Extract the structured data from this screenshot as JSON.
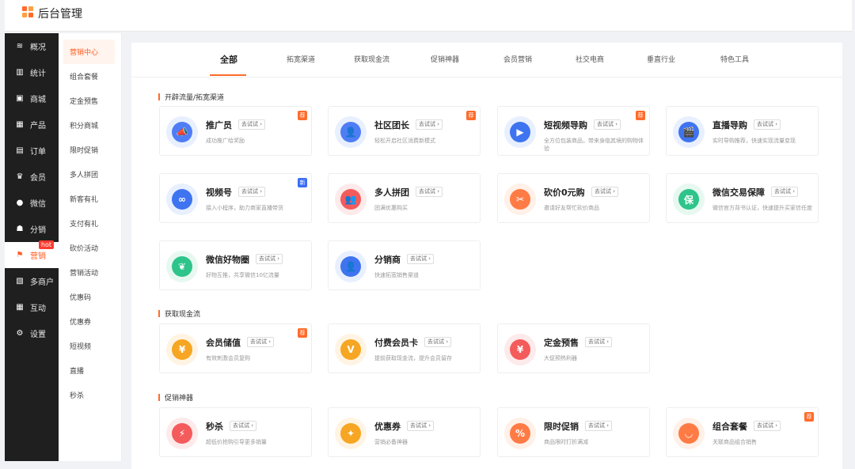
{
  "app": {
    "title": "后台管理"
  },
  "primary_nav": [
    {
      "label": "概况",
      "icon": "stack-icon",
      "glyph": "≋"
    },
    {
      "label": "统计",
      "icon": "bar-chart-icon",
      "glyph": "▥"
    },
    {
      "label": "商城",
      "icon": "store-icon",
      "glyph": "▣"
    },
    {
      "label": "产品",
      "icon": "grid-icon",
      "glyph": "▦"
    },
    {
      "label": "订单",
      "icon": "order-icon",
      "glyph": "▤"
    },
    {
      "label": "会员",
      "icon": "crown-icon",
      "glyph": "♛"
    },
    {
      "label": "微信",
      "icon": "wechat-icon",
      "glyph": "●"
    },
    {
      "label": "分销",
      "icon": "users-icon",
      "glyph": "☗"
    },
    {
      "label": "营销",
      "icon": "flag-icon",
      "glyph": "⚑",
      "badge": "hot"
    },
    {
      "label": "多商户",
      "icon": "shop-icon",
      "glyph": "▧"
    },
    {
      "label": "互动",
      "icon": "apps-icon",
      "glyph": "▦"
    },
    {
      "label": "设置",
      "icon": "gear-icon",
      "glyph": "⚙"
    }
  ],
  "secondary_nav": [
    "营销中心",
    "组合套餐",
    "定金预售",
    "积分商城",
    "限时促销",
    "多人拼团",
    "新客有礼",
    "支付有礼",
    "砍价活动",
    "营销活动",
    "优惠码",
    "优惠券",
    "短视频",
    "直播",
    "秒杀"
  ],
  "tabs": [
    "全部",
    "拓宽渠道",
    "获取现金流",
    "促销神器",
    "会员营销",
    "社交电商",
    "垂直行业",
    "特色工具"
  ],
  "try_label": "去试试",
  "badges": {
    "recommend": "荐",
    "new": "新"
  },
  "sections": [
    {
      "title": "开辟流量/拓宽渠道",
      "cards": [
        {
          "name": "推广员",
          "desc": "成功推广给奖励",
          "badge": "recommend",
          "icon": "megaphone-icon",
          "glyph": "📣",
          "color": "#4f7df5",
          "bg": "#e8f0ff"
        },
        {
          "name": "社区团长",
          "desc": "轻松开启社区消费新模式",
          "badge": "recommend",
          "icon": "community-icon",
          "glyph": "👤",
          "color": "#4f7df5",
          "bg": "#e8f0ff"
        },
        {
          "name": "短视频导购",
          "desc": "全方位包装商品，带来身临其境的购物体验",
          "badge": "recommend",
          "icon": "video-bag-icon",
          "glyph": "▶",
          "color": "#3f74f0",
          "bg": "#e8f0ff"
        },
        {
          "name": "直播导购",
          "desc": "实时导购推荐，快速实现流量变现",
          "badge": "",
          "icon": "clapper-icon",
          "glyph": "🎬",
          "color": "#3f74f0",
          "bg": "#e8f0ff"
        },
        {
          "name": "视频号",
          "desc": "接入小程序，助力商家直播带货",
          "badge": "new",
          "icon": "channels-icon",
          "glyph": "∞",
          "color": "#3f74f0",
          "bg": "#e8f0ff"
        },
        {
          "name": "多人拼团",
          "desc": "团满优惠购买",
          "badge": "",
          "icon": "group-icon",
          "glyph": "👥",
          "color": "#f45b5b",
          "bg": "#fdeaea"
        },
        {
          "name": "砍价0元购",
          "desc": "邀请好友帮忙砍价商品",
          "badge": "",
          "icon": "scissors-icon",
          "glyph": "✂",
          "color": "#ff7b45",
          "bg": "#fff0e8"
        },
        {
          "name": "微信交易保障",
          "desc": "微信官方背书认证，快速提升买家信任度",
          "badge": "",
          "icon": "shield-icon",
          "glyph": "保",
          "color": "#2ec48a",
          "bg": "#e7f8f0"
        },
        {
          "name": "微信好物圈",
          "desc": "好物互推，共享微信10亿流量",
          "badge": "",
          "icon": "sprout-icon",
          "glyph": "❦",
          "color": "#2ec48a",
          "bg": "#e7f8f0"
        },
        {
          "name": "分销商",
          "desc": "快速拓宽销售渠道",
          "badge": "",
          "icon": "person-icon",
          "glyph": "👤",
          "color": "#3f74f0",
          "bg": "#e8f0ff"
        }
      ]
    },
    {
      "title": "获取现金流",
      "cards": [
        {
          "name": "会员储值",
          "desc": "有效刺激会员复购",
          "badge": "recommend",
          "icon": "coin-stack-icon",
          "glyph": "¥",
          "color": "#f6a623",
          "bg": "#fff4e3"
        },
        {
          "name": "付费会员卡",
          "desc": "提前获取现金流，提升会员留存",
          "badge": "",
          "icon": "vip-card-icon",
          "glyph": "V",
          "color": "#f6a623",
          "bg": "#fff4e3"
        },
        {
          "name": "定金预售",
          "desc": "大促预热利器",
          "badge": "",
          "icon": "money-bag-icon",
          "glyph": "¥",
          "color": "#f45b5b",
          "bg": "#fdeaea"
        }
      ]
    },
    {
      "title": "促销神器",
      "cards": [
        {
          "name": "秒杀",
          "desc": "超低价抢购引导更多销量",
          "badge": "",
          "icon": "flash-icon",
          "glyph": "⚡",
          "color": "#f45b5b",
          "bg": "#fdeaea"
        },
        {
          "name": "优惠券",
          "desc": "营销必备神器",
          "badge": "",
          "icon": "coupon-icon",
          "glyph": "✦",
          "color": "#f6a623",
          "bg": "#fff4e3"
        },
        {
          "name": "限时促销",
          "desc": "商品限时打折满减",
          "badge": "",
          "icon": "discount-icon",
          "glyph": "%",
          "color": "#ff7b45",
          "bg": "#fff0e8"
        },
        {
          "name": "组合套餐",
          "desc": "关联商品组合销售",
          "badge": "recommend",
          "icon": "bag-icon",
          "glyph": "◡",
          "color": "#ff7b45",
          "bg": "#fff0e8"
        }
      ]
    }
  ]
}
